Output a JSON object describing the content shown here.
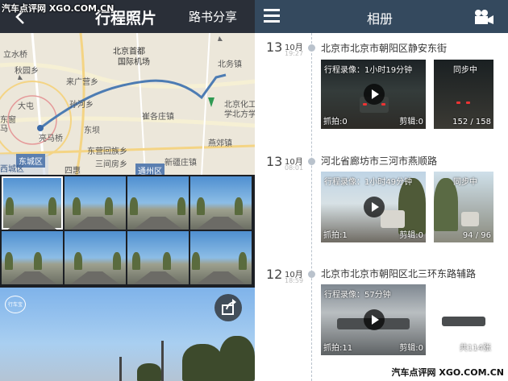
{
  "watermark": {
    "top_left": "汽车点评网 XGO.COM.CN",
    "bottom_right": "汽车点评网 XGO.COM.CN"
  },
  "left": {
    "header": {
      "title": "行程照片",
      "share_label": "路书分享"
    },
    "map_labels": [
      "立水桥",
      "北京首都",
      "国际机场",
      "北务镇",
      "秋园乡",
      "来广营乡",
      "北京化工大",
      "学北方学",
      "大屯",
      "东坝",
      "孙河乡",
      "亮马桥",
      "崔各庄镇",
      "东窗",
      "东营回族乡",
      "燕郊镇",
      "东城区",
      "西城区",
      "四惠",
      "通州区",
      "马",
      "三间房乡",
      "新疆庄镇"
    ],
    "district_tags": [
      "东城区",
      "通州区"
    ],
    "photo_badge": "行车宝"
  },
  "right": {
    "header": {
      "title": "相册"
    },
    "entries": [
      {
        "day": "13",
        "month": "10月",
        "time": "19:27",
        "location": "北京市北京市朝阳区静安东街",
        "video": {
          "caption": "行程录像：1小时19分钟",
          "snaps": "抓拍:0",
          "edits": "剪辑:0"
        },
        "photo": {
          "status": "同步中",
          "count": "152 / 158"
        }
      },
      {
        "day": "13",
        "month": "10月",
        "time": "08:01",
        "location": "河北省廊坊市三河市燕顺路",
        "video": {
          "caption": "行程录像：1小时49分钟",
          "snaps": "抓拍:1",
          "edits": "剪辑:0"
        },
        "photo": {
          "status": "同步中",
          "count": "94 / 96"
        }
      },
      {
        "day": "12",
        "month": "10月",
        "time": "18:59",
        "location": "北京市北京市朝阳区北三环东路辅路",
        "video": {
          "caption": "行程录像：57分钟",
          "snaps": "抓拍:11",
          "edits": "剪辑:0"
        },
        "photo": {
          "status": "",
          "count": "共114张"
        }
      }
    ]
  }
}
